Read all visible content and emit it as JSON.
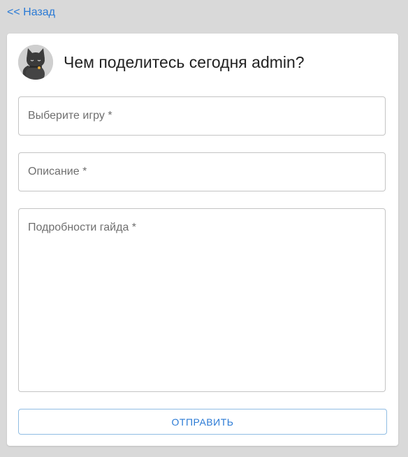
{
  "nav": {
    "back_label": "<< Назад"
  },
  "header": {
    "title": "Чем поделитесь сегодня admin?",
    "avatar_icon": "cat-avatar-icon"
  },
  "form": {
    "game_placeholder": "Выберите игру *",
    "description_placeholder": "Описание *",
    "details_placeholder": "Подробности гайда *",
    "submit_label": "ОТПРАВИТЬ"
  },
  "colors": {
    "background": "#d9d9d9",
    "card": "#ffffff",
    "accent": "#2a7ad5",
    "field_border": "#c4c4c4",
    "button_border": "#90bde3"
  }
}
